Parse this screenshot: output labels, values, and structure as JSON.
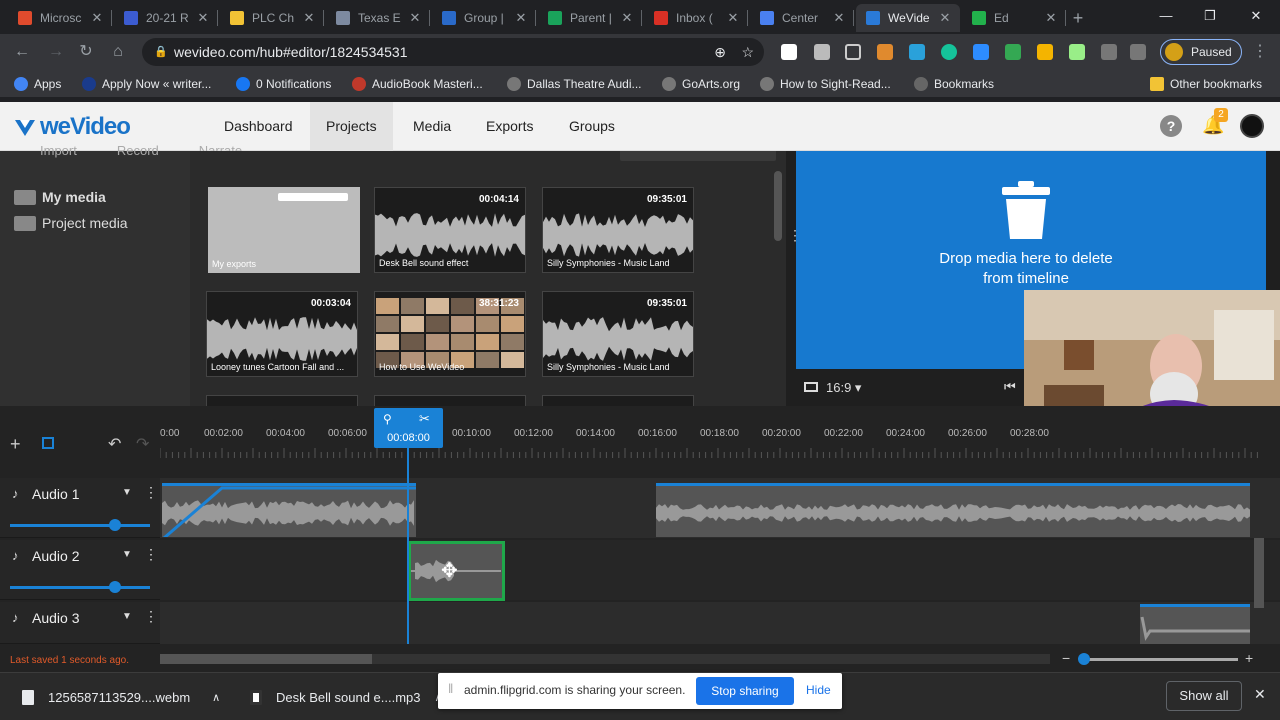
{
  "browser": {
    "tabs": [
      {
        "title": "Microsc",
        "color": "#e04b2d",
        "active": false
      },
      {
        "title": "20-21 R",
        "color": "#3c5cd1",
        "active": false
      },
      {
        "title": "PLC Ch",
        "color": "#f2c335",
        "active": false
      },
      {
        "title": "Texas E",
        "color": "#7d8aa0",
        "active": false
      },
      {
        "title": "Group |",
        "color": "#2a6ac9",
        "active": false
      },
      {
        "title": "Parent |",
        "color": "#1aa35b",
        "active": false
      },
      {
        "title": "Inbox (",
        "color": "#d93025",
        "active": false
      },
      {
        "title": "Center",
        "color": "#4a80f0",
        "active": false
      },
      {
        "title": "WeVide",
        "color": "#2a7ad8",
        "active": true
      },
      {
        "title": "Ed",
        "color": "#22b14c",
        "active": false
      }
    ],
    "url": "wevideo.com/hub#editor/1824534531",
    "profile_status": "Paused",
    "bookmarks": [
      {
        "label": "Apps",
        "icon": "apps-icon"
      },
      {
        "label": "Apply Now « writer...",
        "icon": "shield-icon"
      },
      {
        "label": "0 Notifications",
        "icon": "facebook-icon"
      },
      {
        "label": "AudioBook Masteri...",
        "icon": "audiobook-icon"
      },
      {
        "label": "Dallas Theatre Audi...",
        "icon": "globe-icon"
      },
      {
        "label": "GoArts.org",
        "icon": "globe-icon"
      },
      {
        "label": "How to Sight-Read...",
        "icon": "globe-icon"
      },
      {
        "label": "Bookmarks",
        "icon": "star-icon"
      },
      {
        "label": "Other bookmarks",
        "icon": "folder-icon"
      }
    ]
  },
  "app": {
    "brand": "weVideo",
    "nav": [
      {
        "label": "Dashboard",
        "selected": false
      },
      {
        "label": "Projects",
        "selected": true
      },
      {
        "label": "Media",
        "selected": false
      },
      {
        "label": "Exports",
        "selected": false
      },
      {
        "label": "Groups",
        "selected": false
      }
    ],
    "notification_count": "2"
  },
  "media": {
    "toolbar": [
      "Import",
      "Record",
      "Narrate"
    ],
    "sidebar": [
      "My media",
      "Project media"
    ],
    "items": [
      {
        "name": "My exports",
        "duration": "",
        "kind": "folder"
      },
      {
        "name": "Desk Bell sound effect",
        "duration": "00:04:14",
        "kind": "audio"
      },
      {
        "name": "Silly Symphonies - Music Land",
        "duration": "09:35:01",
        "kind": "audio"
      },
      {
        "name": "Looney tunes Cartoon Fall and ...",
        "duration": "00:03:04",
        "kind": "audio"
      },
      {
        "name": "How to Use WeVideo",
        "duration": "38:31:23",
        "kind": "video"
      },
      {
        "name": "Silly Symphonies - Music Land",
        "duration": "09:35:01",
        "kind": "audio"
      }
    ]
  },
  "preview": {
    "drop_text_line1": "Drop media here to delete",
    "drop_text_line2": "from timeline",
    "aspect": "16:9"
  },
  "timeline": {
    "ticks": [
      "0:00",
      "00:02:00",
      "00:04:00",
      "00:06:00",
      "00:08:00",
      "00:10:00",
      "00:12:00",
      "00:14:00",
      "00:16:00",
      "00:18:00",
      "00:20:00",
      "00:22:00",
      "00:24:00",
      "00:26:00",
      "00:28:00"
    ],
    "playhead_time": "00:08:00",
    "tracks": [
      {
        "name": "Audio 1"
      },
      {
        "name": "Audio 2"
      },
      {
        "name": "Audio 3"
      }
    ],
    "status": "Last saved 1 seconds ago."
  },
  "downloads": {
    "files": [
      "1256587113529....webm",
      "Desk Bell sound e....mp3"
    ],
    "share_message": "admin.flipgrid.com is sharing your screen.",
    "stop_label": "Stop sharing",
    "hide_label": "Hide",
    "show_all": "Show all"
  }
}
